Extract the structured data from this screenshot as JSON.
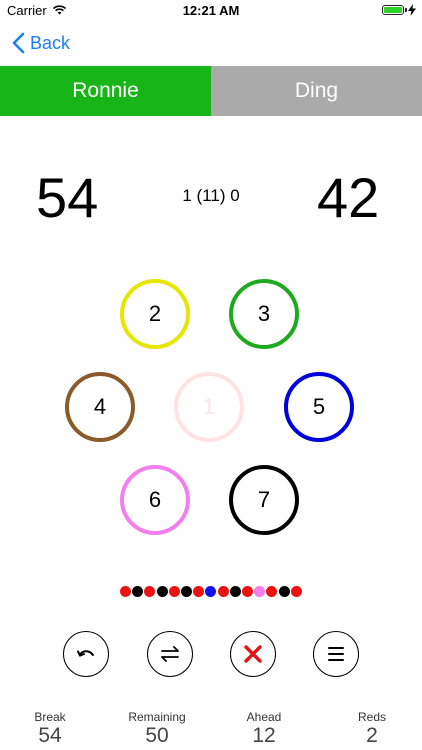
{
  "status_bar": {
    "carrier": "Carrier",
    "time": "12:21 AM"
  },
  "nav": {
    "back_label": "Back"
  },
  "players": {
    "left_name": "Ronnie",
    "right_name": "Ding",
    "left_score": "54",
    "right_score": "42",
    "frame_status": "1 (11) 0"
  },
  "balls": [
    {
      "value": "2",
      "color": "#e6e600"
    },
    {
      "value": "3",
      "color": "#1eaa1e"
    },
    {
      "value": "4",
      "color": "#8b5a2b"
    },
    {
      "value": "1",
      "color": "#ffe3e3",
      "disabled": true
    },
    {
      "value": "5",
      "color": "#0000dd"
    },
    {
      "value": "6",
      "color": "#f47ef0"
    },
    {
      "value": "7",
      "color": "#000000"
    }
  ],
  "potted_history": [
    "red",
    "black",
    "red",
    "black",
    "red",
    "black",
    "red",
    "blue",
    "red",
    "black",
    "red",
    "pink",
    "red",
    "black",
    "red"
  ],
  "colors": {
    "red": "#ee1111",
    "black": "#000000",
    "blue": "#1111ee",
    "pink": "#f47ef0",
    "accent": "#1a7ff5",
    "active_tab": "#17b517",
    "inactive_tab": "#aaaaaa"
  },
  "actions": [
    "undo-icon",
    "swap-icon",
    "cross-icon",
    "menu-icon"
  ],
  "stats": {
    "break_label": "Break",
    "break_value": "54",
    "remaining_label": "Remaining",
    "remaining_value": "50",
    "ahead_label": "Ahead",
    "ahead_value": "12",
    "reds_label": "Reds",
    "reds_value": "2"
  }
}
